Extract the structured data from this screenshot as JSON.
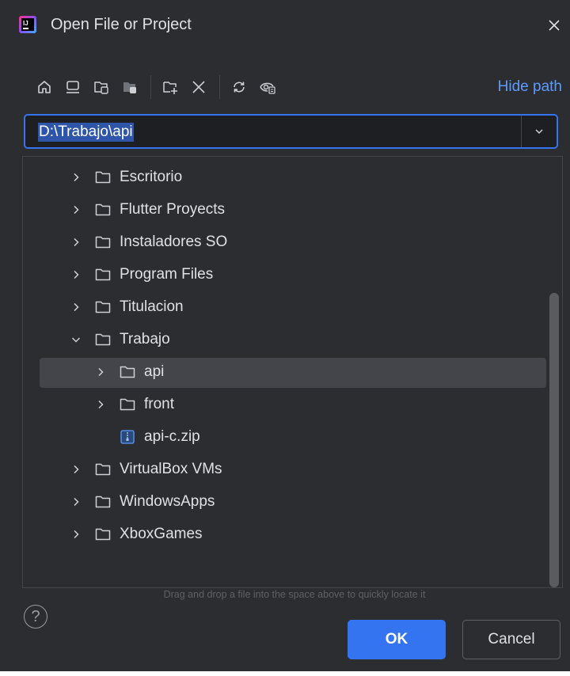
{
  "window": {
    "title": "Open File or Project",
    "app_icon": "jetbrains-app-icon",
    "close_icon": "close-icon"
  },
  "toolbar": {
    "buttons": [
      {
        "name": "home-icon",
        "tooltip": ""
      },
      {
        "name": "desktop-icon",
        "tooltip": ""
      },
      {
        "name": "project-folder-icon",
        "tooltip": ""
      },
      {
        "name": "module-folder-icon",
        "tooltip": ""
      },
      {
        "name": "new-folder-icon",
        "tooltip": ""
      },
      {
        "name": "delete-icon",
        "tooltip": ""
      },
      {
        "name": "refresh-icon",
        "tooltip": ""
      },
      {
        "name": "show-hidden-icon",
        "tooltip": ""
      }
    ],
    "hide_path_label": "Hide path"
  },
  "path": {
    "value": "D:\\Trabajo\\api",
    "dropdown_icon": "chevron-down-icon"
  },
  "tree": {
    "items": [
      {
        "label": "Escritorio",
        "type": "folder",
        "expanded": false,
        "depth": 0
      },
      {
        "label": "Flutter Proyects",
        "type": "folder",
        "expanded": false,
        "depth": 0
      },
      {
        "label": "Instaladores SO",
        "type": "folder",
        "expanded": false,
        "depth": 0
      },
      {
        "label": "Program Files",
        "type": "folder",
        "expanded": false,
        "depth": 0
      },
      {
        "label": "Titulacion",
        "type": "folder",
        "expanded": false,
        "depth": 0
      },
      {
        "label": "Trabajo",
        "type": "folder",
        "expanded": true,
        "depth": 0
      },
      {
        "label": "api",
        "type": "folder",
        "expanded": false,
        "depth": 1,
        "selected": true
      },
      {
        "label": "front",
        "type": "folder",
        "expanded": false,
        "depth": 1
      },
      {
        "label": "api-c.zip",
        "type": "archive",
        "depth": 1
      },
      {
        "label": "VirtualBox VMs",
        "type": "folder",
        "expanded": false,
        "depth": 0
      },
      {
        "label": "WindowsApps",
        "type": "folder",
        "expanded": false,
        "depth": 0
      },
      {
        "label": "XboxGames",
        "type": "folder",
        "expanded": false,
        "depth": 0
      }
    ]
  },
  "hint": "Drag and drop a file into the space above to quickly locate it",
  "footer": {
    "help_label": "?",
    "ok_label": "OK",
    "cancel_label": "Cancel"
  },
  "colors": {
    "background": "#2b2d30",
    "accent": "#3574f0",
    "link": "#5e9bff",
    "selection": "#43454a"
  }
}
